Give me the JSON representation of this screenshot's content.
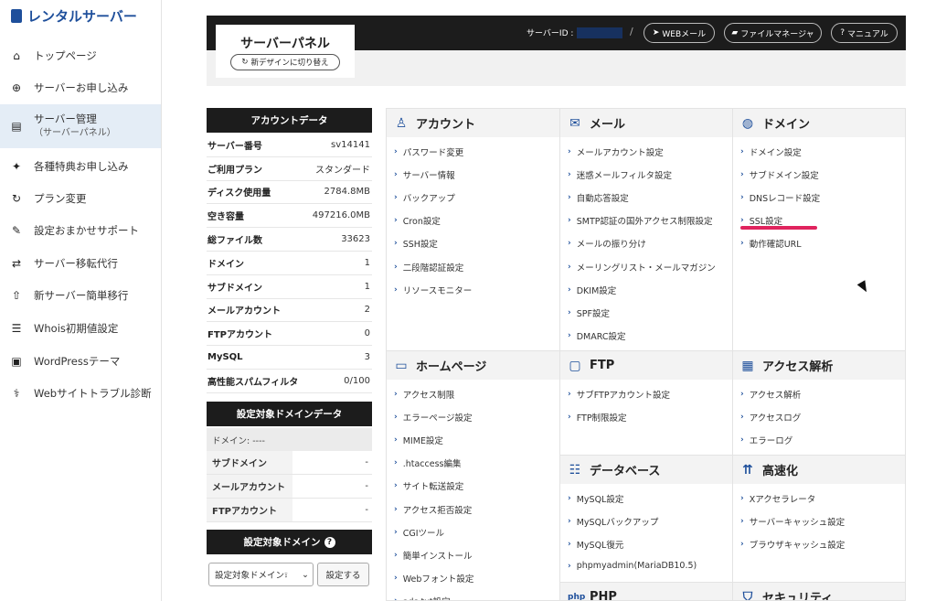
{
  "brand": {
    "name": "レンタルサーバー"
  },
  "sidebar": {
    "items": [
      {
        "label": "トップページ",
        "icon": "home-icon",
        "glyph": "⌂"
      },
      {
        "label": "サーバーお申し込み",
        "icon": "plus-circle-icon",
        "glyph": "⊕"
      },
      {
        "label": "サーバー管理",
        "sublabel": "（サーバーパネル）",
        "icon": "server-icon",
        "glyph": "▤",
        "active": true
      },
      {
        "label": "各種特典お申し込み",
        "icon": "gift-icon",
        "glyph": "✦"
      },
      {
        "label": "プラン変更",
        "icon": "refresh-icon",
        "glyph": "↻"
      },
      {
        "label": "設定おまかせサポート",
        "icon": "wrench-icon",
        "glyph": "✎"
      },
      {
        "label": "サーバー移転代行",
        "icon": "transfer-icon",
        "glyph": "⇄"
      },
      {
        "label": "新サーバー簡単移行",
        "icon": "upload-icon",
        "glyph": "⇧"
      },
      {
        "label": "Whois初期値設定",
        "icon": "document-icon",
        "glyph": "☰"
      },
      {
        "label": "WordPressテーマ",
        "icon": "window-icon",
        "glyph": "▣"
      },
      {
        "label": "Webサイトトラブル診断",
        "icon": "stethoscope-icon",
        "glyph": "⚕"
      }
    ]
  },
  "header": {
    "title": "サーバーパネル",
    "new_design_label": "新デザインに切り替え",
    "server_id_label": "サーバーID :",
    "separator": "/",
    "webmail_label": "WEBメール",
    "filemanager_label": "ファイルマネージャ",
    "manual_label": "マニュアル"
  },
  "account_data": {
    "title": "アカウントデータ",
    "rows": [
      {
        "key": "サーバー番号",
        "value": "sv14141"
      },
      {
        "key": "ご利用プラン",
        "value": "スタンダード"
      },
      {
        "key": "ディスク使用量",
        "value": "2784.8MB"
      },
      {
        "key": "空き容量",
        "value": "497216.0MB"
      },
      {
        "key": "総ファイル数",
        "value": "33623"
      },
      {
        "key": "ドメイン",
        "value": "1"
      },
      {
        "key": "サブドメイン",
        "value": "1"
      },
      {
        "key": "メールアカウント",
        "value": "2"
      },
      {
        "key": "FTPアカウント",
        "value": "0"
      },
      {
        "key": "MySQL",
        "value": "3"
      },
      {
        "key": "高性能スパムフィルタ",
        "value": "0/100"
      }
    ]
  },
  "domain_data": {
    "title": "設定対象ドメインデータ",
    "domain_row": "ドメイン: ----",
    "rows": [
      {
        "key": "サブドメイン",
        "value": "-"
      },
      {
        "key": "メールアカウント",
        "value": "-"
      },
      {
        "key": "FTPアカウント",
        "value": "-"
      }
    ]
  },
  "target_domain": {
    "title": "設定対象ドメイン",
    "help_glyph": "?",
    "select_value": "設定対象ドメイン፣",
    "button_label": "設定する"
  },
  "sections": {
    "account": {
      "title": "アカウント",
      "icon": "user-icon",
      "glyph": "♙",
      "links": [
        "パスワード変更",
        "サーバー情報",
        "バックアップ",
        "Cron設定",
        "SSH設定",
        "二段階認証設定",
        "リソースモニター"
      ]
    },
    "mail": {
      "title": "メール",
      "icon": "envelope-icon",
      "glyph": "✉",
      "links": [
        "メールアカウント設定",
        "迷惑メールフィルタ設定",
        "自動応答設定",
        "SMTP認証の国外アクセス制限設定",
        "メールの振り分け",
        "メーリングリスト・メールマガジン",
        "DKIM設定",
        "SPF設定",
        "DMARC設定"
      ]
    },
    "domain": {
      "title": "ドメイン",
      "icon": "globe-icon",
      "glyph": "◍",
      "links": [
        "ドメイン設定",
        "サブドメイン設定",
        "DNSレコード設定",
        "SSL設定",
        "動作確認URL"
      ]
    },
    "homepage": {
      "title": "ホームページ",
      "icon": "browser-icon",
      "glyph": "▭",
      "links": [
        "アクセス制限",
        "エラーページ設定",
        "MIME設定",
        ".htaccess編集",
        "サイト転送設定",
        "アクセス拒否設定",
        "CGIツール",
        "簡単インストール",
        "Webフォント設定",
        "ads.txt設定"
      ]
    },
    "ftp": {
      "title": "FTP",
      "icon": "monitor-icon",
      "glyph": "▢",
      "links": [
        "サブFTPアカウント設定",
        "FTP制限設定"
      ]
    },
    "analytics": {
      "title": "アクセス解析",
      "icon": "bar-chart-icon",
      "glyph": "▦",
      "links": [
        "アクセス解析",
        "アクセスログ",
        "エラーログ"
      ]
    },
    "database": {
      "title": "データベース",
      "icon": "database-icon",
      "glyph": "☷",
      "links": [
        "MySQL設定",
        "MySQLバックアップ",
        "MySQL復元",
        "phpmyadmin(MariaDB10.5)"
      ]
    },
    "speed": {
      "title": "高速化",
      "icon": "speed-icon",
      "glyph": "⇈",
      "links": [
        "Xアクセラレータ",
        "サーバーキャッシュ設定",
        "ブラウザキャッシュ設定"
      ]
    },
    "php": {
      "title": "PHP",
      "icon": "php-icon",
      "glyph": "php"
    },
    "security": {
      "title": "セキュリティ",
      "icon": "shield-icon",
      "glyph": "⛉"
    }
  },
  "colors": {
    "accent": "#1e4f9b",
    "dark": "#1c1c1c",
    "highlight": "#e0245e",
    "active_bg": "#e4edf6"
  }
}
